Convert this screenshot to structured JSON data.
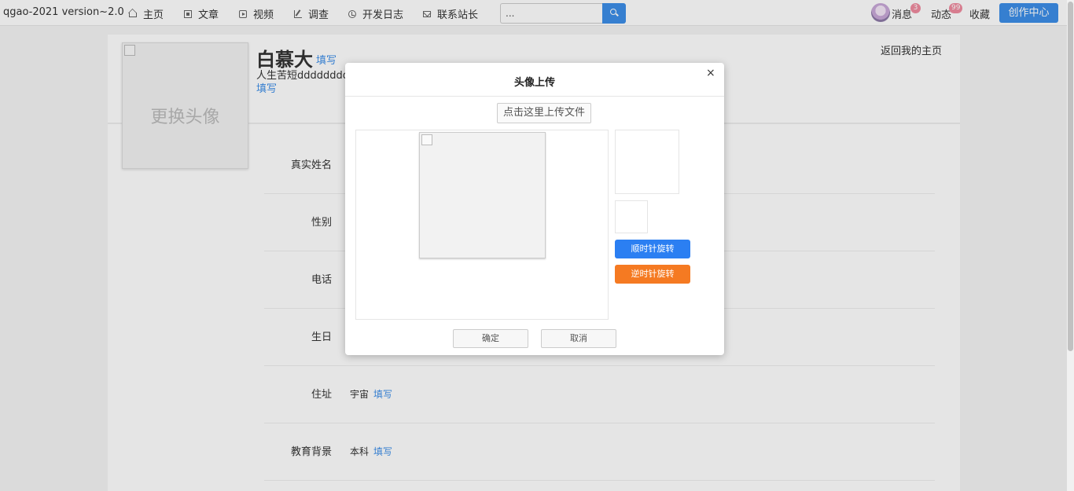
{
  "brand": "qgao-2021 version~2.0",
  "nav": [
    {
      "label": "主页",
      "icon": "home-icon"
    },
    {
      "label": "文章",
      "icon": "article-icon"
    },
    {
      "label": "视频",
      "icon": "video-icon"
    },
    {
      "label": "调查",
      "icon": "survey-icon"
    },
    {
      "label": "开发日志",
      "icon": "clock-icon"
    },
    {
      "label": "联系站长",
      "icon": "mail-icon"
    }
  ],
  "search": {
    "value": "..."
  },
  "topright": {
    "messages_label": "消息",
    "messages_count": "3",
    "activity_label": "动态",
    "activity_count": "99",
    "favorites_label": "收藏",
    "create_label": "创作中心"
  },
  "profile": {
    "avatar_caption": "更换头像",
    "username": "白慕大",
    "username_fill": "填写",
    "bio": "人生苦短dddddddd",
    "bio_fill": "填写",
    "back_home": "返回我的主页"
  },
  "fields": [
    {
      "label": "真实姓名",
      "value": "",
      "fill": ""
    },
    {
      "label": "性别",
      "value": "",
      "fill": ""
    },
    {
      "label": "电话",
      "value": "",
      "fill": ""
    },
    {
      "label": "生日",
      "value": "",
      "fill": ""
    },
    {
      "label": "住址",
      "value": "宇宙",
      "fill": "填写"
    },
    {
      "label": "教育背景",
      "value": "本科",
      "fill": "填写"
    }
  ],
  "modal": {
    "title": "头像上传",
    "close": "×",
    "upload_label": "点击这里上传文件",
    "rotate_cw": "顺时针旋转",
    "rotate_ccw": "逆时针旋转",
    "confirm": "确定",
    "cancel": "取消"
  },
  "colors": {
    "accent": "#3d8ee8",
    "rotate_cw": "#2b7ff2",
    "rotate_ccw": "#f57a22",
    "badge": "#f08ca0"
  }
}
